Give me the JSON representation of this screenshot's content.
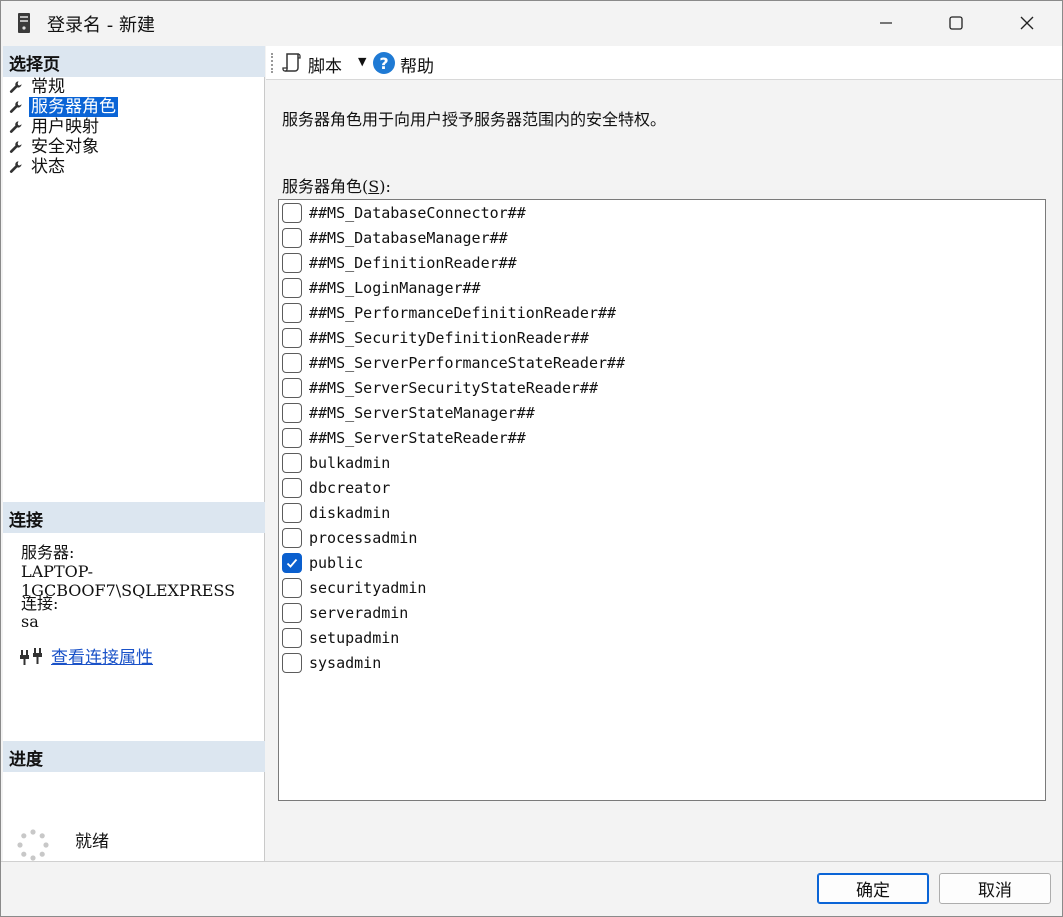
{
  "window": {
    "title": "登录名 - 新建"
  },
  "left": {
    "pages_header": "选择页",
    "pages": [
      {
        "label": "常规",
        "selected": false
      },
      {
        "label": "服务器角色",
        "selected": true
      },
      {
        "label": "用户映射",
        "selected": false
      },
      {
        "label": "安全对象",
        "selected": false
      },
      {
        "label": "状态",
        "selected": false
      }
    ],
    "connection_header": "连接",
    "server_label": "服务器:",
    "server_value": "LAPTOP-1GCBOOF7\\SQLEXPRESS",
    "login_label": "连接:",
    "login_value": "sa",
    "view_props_link": "查看连接属性",
    "progress_header": "进度",
    "progress_status": "就绪"
  },
  "toolbar": {
    "script_label": "脚本",
    "help_label": "帮助"
  },
  "main": {
    "description": "服务器角色用于向用户授予服务器范围内的安全特权。",
    "roles_label_prefix": "服务器角色(",
    "roles_label_key": "S",
    "roles_label_suffix": "):",
    "roles": [
      {
        "name": "##MS_DatabaseConnector##",
        "checked": false
      },
      {
        "name": "##MS_DatabaseManager##",
        "checked": false
      },
      {
        "name": "##MS_DefinitionReader##",
        "checked": false
      },
      {
        "name": "##MS_LoginManager##",
        "checked": false
      },
      {
        "name": "##MS_PerformanceDefinitionReader##",
        "checked": false
      },
      {
        "name": "##MS_SecurityDefinitionReader##",
        "checked": false
      },
      {
        "name": "##MS_ServerPerformanceStateReader##",
        "checked": false
      },
      {
        "name": "##MS_ServerSecurityStateReader##",
        "checked": false
      },
      {
        "name": "##MS_ServerStateManager##",
        "checked": false
      },
      {
        "name": "##MS_ServerStateReader##",
        "checked": false
      },
      {
        "name": "bulkadmin",
        "checked": false
      },
      {
        "name": "dbcreator",
        "checked": false
      },
      {
        "name": "diskadmin",
        "checked": false
      },
      {
        "name": "processadmin",
        "checked": false
      },
      {
        "name": "public",
        "checked": true
      },
      {
        "name": "securityadmin",
        "checked": false
      },
      {
        "name": "serveradmin",
        "checked": false
      },
      {
        "name": "setupadmin",
        "checked": false
      },
      {
        "name": "sysadmin",
        "checked": false
      }
    ]
  },
  "buttons": {
    "ok": "确定",
    "cancel": "取消"
  },
  "colors": {
    "accent": "#0a64d6",
    "section_header_bg": "#dce6f0",
    "link": "#1a52c8"
  }
}
